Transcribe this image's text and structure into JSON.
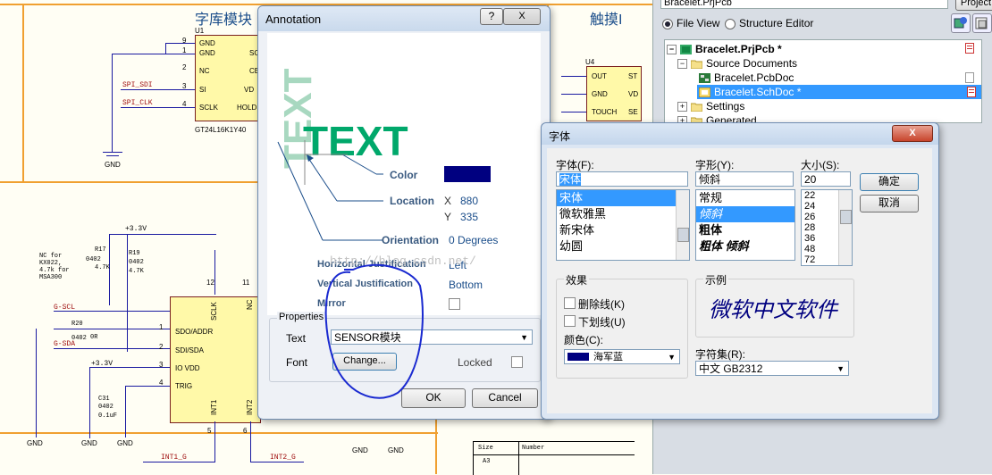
{
  "schematic": {
    "header_left": "字库模块",
    "header_right": "触摸I",
    "u1": {
      "ref": "U1",
      "part": "GT24L16K1Y40",
      "pins_left": [
        {
          "num": "9",
          "name": "GND"
        },
        {
          "num": "1",
          "name": "GND"
        },
        {
          "num": "2",
          "name": "NC"
        },
        {
          "num": "3",
          "name": "SI"
        },
        {
          "num": "4",
          "name": "SCLK"
        }
      ],
      "pins_right": [
        "SC",
        "CE",
        "VD",
        "HOLD"
      ]
    },
    "net_spi_sdi": "SPI_SDI",
    "net_spi_clk": "SPI_CLK",
    "u4": {
      "ref": "U4",
      "pins": [
        "OUT",
        "GND",
        "TOUCH"
      ],
      "pins_right": [
        "ST",
        "VD",
        "SE"
      ]
    },
    "gnd": "GND",
    "power": "+3.3V",
    "power2": "+3.3V",
    "r17": {
      "ref": "R17",
      "pkg": "0402",
      "val": "4.7K"
    },
    "r19": {
      "ref": "R19",
      "pkg": "0402",
      "val": "4.7K"
    },
    "note": "NC for\nKX022,\n4.7k for\nMSA300",
    "net_gscl": "G-SCL",
    "net_gsda": "G-SDA",
    "r20": {
      "ref": "R20",
      "pkg": "0402",
      "val": "0R"
    },
    "c31": {
      "ref": "C31",
      "pkg": "0402",
      "val": "0.1uF"
    },
    "u_sensor": {
      "top_pins": [
        {
          "num": "12",
          "name": "SCLK"
        },
        {
          "num": "11",
          "name": "NC"
        }
      ],
      "left_pins": [
        {
          "num": "1",
          "name": "SDO/ADDR"
        },
        {
          "num": "2",
          "name": "SDI/SDA"
        },
        {
          "num": "3",
          "name": "IO VDD"
        },
        {
          "num": "4",
          "name": "TRIG"
        }
      ],
      "bottom_pins": [
        {
          "num": "5",
          "name": "INT1"
        },
        {
          "num": "6",
          "name": "INT2"
        }
      ]
    },
    "net_int1": "INT1_G",
    "net_int2": "INT2_G",
    "title_block": {
      "size_label": "Size",
      "size_value": "A3",
      "number_label": "Number"
    }
  },
  "project_panel": {
    "top_field": "Bracelet.PrjPcb",
    "top_button": "Project",
    "file_view": "File View",
    "structure_editor": "Structure Editor",
    "tree": [
      {
        "label": "Bracelet.PrjPcb *",
        "level": 0,
        "expander": "-",
        "bold": true,
        "selected": false
      },
      {
        "label": "Source Documents",
        "level": 1,
        "expander": "-",
        "bold": false,
        "selected": false
      },
      {
        "label": "Bracelet.PcbDoc",
        "level": 2,
        "expander": "",
        "bold": false,
        "selected": false
      },
      {
        "label": "Bracelet.SchDoc *",
        "level": 2,
        "expander": "",
        "bold": false,
        "selected": true
      },
      {
        "label": "Settings",
        "level": 1,
        "expander": "+",
        "bold": false,
        "selected": false
      },
      {
        "label": "Generated",
        "level": 1,
        "expander": "+",
        "bold": false,
        "selected": false
      }
    ]
  },
  "annotation_dialog": {
    "title": "Annotation",
    "help_button": "?",
    "close_button": "X",
    "preview_text": "TEXT",
    "preview_text_vertical": "TEXT",
    "color_label": "Color",
    "color_value": "#000080",
    "location_label": "Location",
    "x_label": "X",
    "x_value": "880",
    "y_label": "Y",
    "y_value": "335",
    "orientation_label": "Orientation",
    "orientation_value": "0 Degrees",
    "hjust_label": "Horizontal Justification",
    "hjust_value": "Left",
    "vjust_label": "Vertical Justification",
    "vjust_value": "Bottom",
    "mirror_label": "Mirror",
    "properties_label": "Properties",
    "text_label": "Text",
    "text_value": "SENSOR模块",
    "font_label": "Font",
    "change_button": "Change...",
    "locked_label": "Locked",
    "ok_button": "OK",
    "cancel_button": "Cancel",
    "watermark": "http://blog.csdn.net/"
  },
  "font_dialog": {
    "title": "字体",
    "close_button": "X",
    "font_label": "字体(F):",
    "font_value": "宋体",
    "font_list": [
      "宋体",
      "微软雅黑",
      "新宋体",
      "幼圆"
    ],
    "style_label": "字形(Y):",
    "style_value": "倾斜",
    "style_list": [
      "常规",
      "倾斜",
      "粗体",
      "粗体 倾斜"
    ],
    "size_label": "大小(S):",
    "size_value": "20",
    "size_list": [
      "22",
      "24",
      "26",
      "28",
      "36",
      "48",
      "72"
    ],
    "ok_button": "确定",
    "cancel_button": "取消",
    "effects_label": "效果",
    "strikeout_label": "删除线(K)",
    "underline_label": "下划线(U)",
    "color_label": "颜色(C):",
    "color_value": "海军蓝",
    "color_swatch": "#000080",
    "sample_label": "示例",
    "sample_text": "微软中文软件",
    "charset_label": "字符集(R):",
    "charset_value": "中文 GB2312"
  }
}
